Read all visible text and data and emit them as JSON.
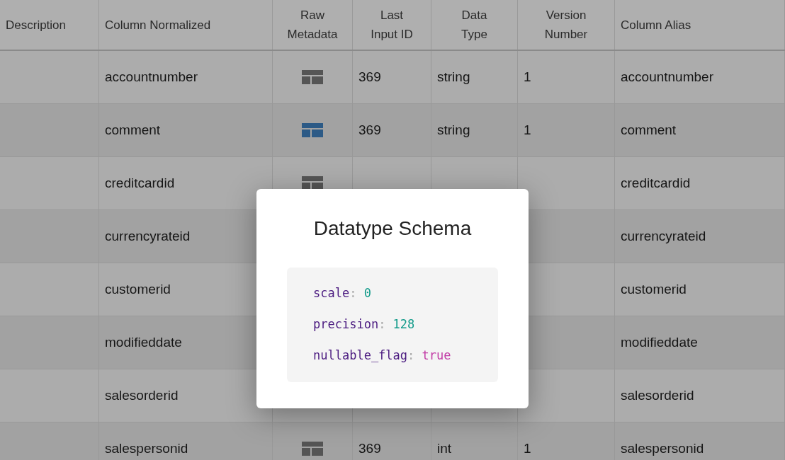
{
  "table": {
    "columns": [
      "Description",
      "Column Normalized",
      "Raw\nMetadata",
      "Last\nInput ID",
      "Data\nType",
      "Version\nNumber",
      "Column Alias"
    ],
    "rows": [
      {
        "column_normalized": "accountnumber",
        "raw_metadata": {
          "active": false
        },
        "last_input_id": "369",
        "data_type": "string",
        "version_number": "1",
        "column_alias": "accountnumber"
      },
      {
        "column_normalized": "comment",
        "raw_metadata": {
          "active": true
        },
        "last_input_id": "369",
        "data_type": "string",
        "version_number": "1",
        "column_alias": "comment"
      },
      {
        "column_normalized": "creditcardid",
        "raw_metadata": {
          "active": false
        },
        "column_alias": "creditcardid"
      },
      {
        "column_normalized": "currencyrateid",
        "column_alias": "currencyrateid"
      },
      {
        "column_normalized": "customerid",
        "column_alias": "customerid"
      },
      {
        "column_normalized": "modifieddate",
        "column_alias": "modifieddate"
      },
      {
        "column_normalized": "salesorderid",
        "column_alias": "salesorderid"
      },
      {
        "column_normalized": "salespersonid",
        "raw_metadata": {
          "active": false
        },
        "last_input_id": "369",
        "data_type": "int",
        "version_number": "1",
        "column_alias": "salespersonid"
      }
    ]
  },
  "dialog": {
    "title": "Datatype Schema",
    "schema": [
      {
        "key": "scale",
        "separator": ":",
        "value": "0",
        "kind": "number"
      },
      {
        "key": "precision",
        "separator": ":",
        "value": "128",
        "kind": "number"
      },
      {
        "key": "nullable_flag",
        "separator": ":",
        "value": "true",
        "kind": "boolean"
      }
    ]
  }
}
